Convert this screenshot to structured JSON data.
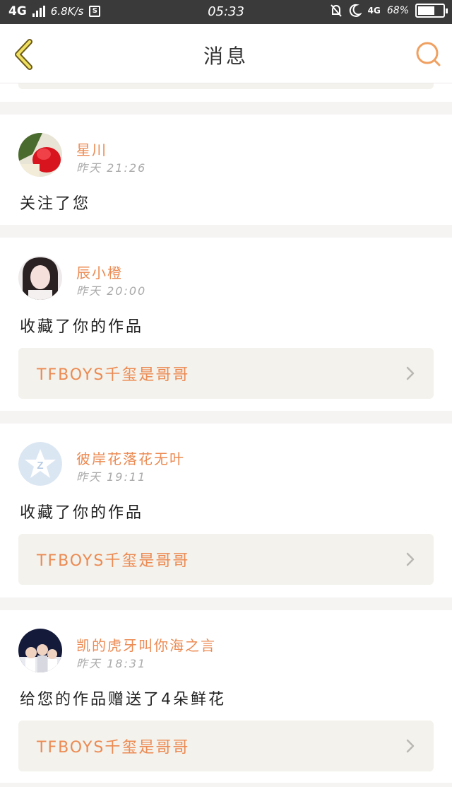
{
  "status_bar": {
    "network": "4G",
    "speed": "6.8K/s",
    "time": "05:33",
    "network2": "4G",
    "battery_percent": "68%",
    "battery_level": 0.68
  },
  "header": {
    "title": "消息",
    "back_icon": "chevron-left-icon",
    "search_icon": "search-icon",
    "accent_color": "#f0a060"
  },
  "messages": [
    {
      "name": "星川",
      "time": "昨天 21:26",
      "action": "关注了您",
      "work": null
    },
    {
      "name": "辰小橙",
      "time": "昨天 20:00",
      "action": "收藏了你的作品",
      "work": "TFBOYS千玺是哥哥"
    },
    {
      "name": "彼岸花落花无叶",
      "time": "昨天 19:11",
      "action": "收藏了你的作品",
      "work": "TFBOYS千玺是哥哥"
    },
    {
      "name": "凯的虎牙叫你海之言",
      "time": "昨天 18:31",
      "action": "给您的作品赠送了4朵鲜花",
      "work": "TFBOYS千玺是哥哥"
    }
  ],
  "colors": {
    "name": "#ec8a52",
    "work_bg": "#f3f2ec",
    "page_bg": "#f6f3f3"
  }
}
